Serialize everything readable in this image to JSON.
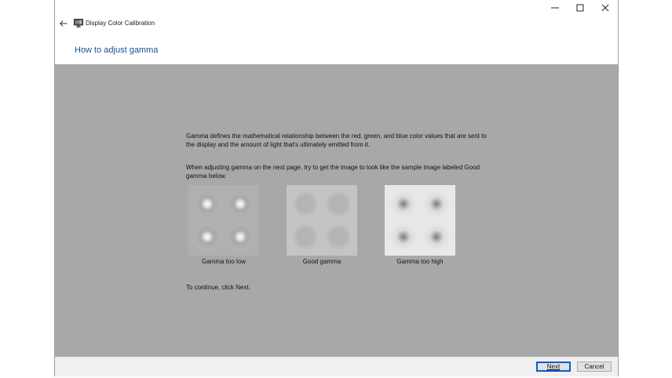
{
  "window": {
    "app_title": "Display Color Calibration",
    "heading": "How to adjust gamma",
    "controls": {
      "minimize_icon": "minimize-icon",
      "maximize_icon": "maximize-icon",
      "close_icon": "close-icon"
    }
  },
  "content": {
    "paragraph1": "Gamma defines the mathematical relationship between the red, green, and blue color values that are sent to the display and the amount of light that's ultimately emitted from it.",
    "paragraph2": "When adjusting gamma on the next page, try to get the image to look like the sample image labeled Good gamma below.",
    "samples": [
      {
        "label": "Gamma too low"
      },
      {
        "label": "Good gamma"
      },
      {
        "label": "Gamma too high"
      }
    ],
    "continue_text": "To continue, click Next."
  },
  "footer": {
    "next_label": "Next",
    "cancel_label": "Cancel"
  },
  "colors": {
    "accent": "#1c4e9b",
    "content_bg": "#a8a8a8",
    "footer_bg": "#f0f0f0",
    "focus_border": "#0b5bd3"
  }
}
